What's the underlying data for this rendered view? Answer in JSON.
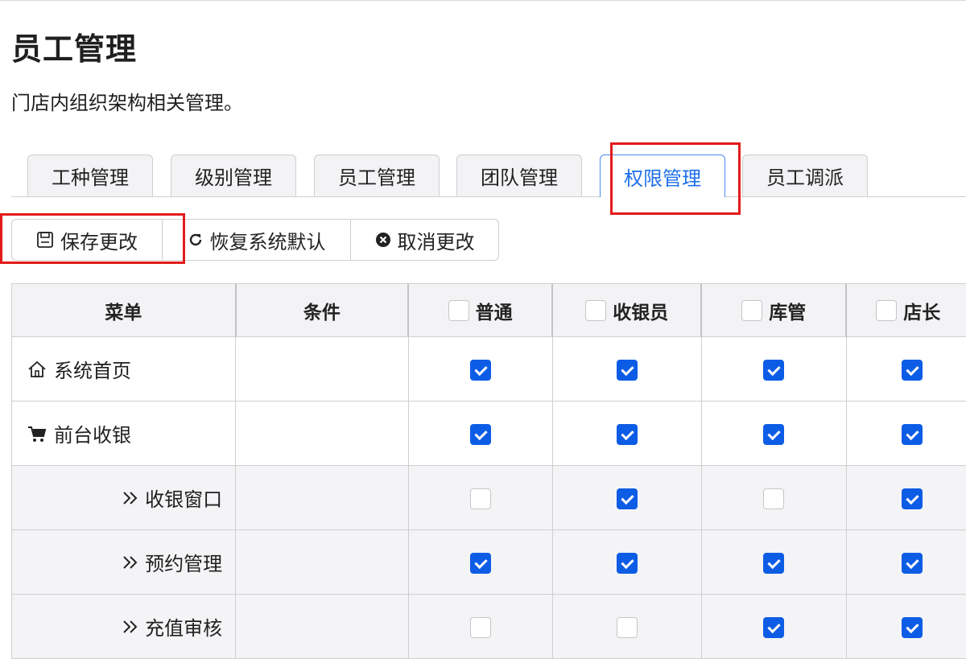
{
  "page": {
    "title": "员工管理",
    "description": "门店内组织架构相关管理。"
  },
  "tabs": [
    {
      "label": "工种管理",
      "active": false
    },
    {
      "label": "级别管理",
      "active": false
    },
    {
      "label": "员工管理",
      "active": false
    },
    {
      "label": "团队管理",
      "active": false
    },
    {
      "label": "权限管理",
      "active": true
    },
    {
      "label": "员工调派",
      "active": false
    }
  ],
  "toolbar": {
    "save_label": "保存更改",
    "restore_label": "恢复系统默认",
    "cancel_label": "取消更改"
  },
  "table": {
    "headers": {
      "menu": "菜单",
      "condition": "条件",
      "roles": [
        {
          "label": "普通",
          "checked": false
        },
        {
          "label": "收银员",
          "checked": false
        },
        {
          "label": "库管",
          "checked": false
        },
        {
          "label": "店长",
          "checked": false
        }
      ]
    },
    "rows": [
      {
        "label": "系统首页",
        "icon": "home-icon",
        "level": "top",
        "condition": "",
        "perms": [
          true,
          true,
          true,
          true
        ]
      },
      {
        "label": "前台收银",
        "icon": "cart-icon",
        "level": "top",
        "condition": "",
        "perms": [
          true,
          true,
          true,
          true
        ]
      },
      {
        "label": "收银窗口",
        "icon": "double-chevron-right-icon",
        "level": "sub",
        "condition": "",
        "perms": [
          false,
          true,
          false,
          true
        ]
      },
      {
        "label": "预约管理",
        "icon": "double-chevron-right-icon",
        "level": "sub",
        "condition": "",
        "perms": [
          true,
          true,
          true,
          true
        ]
      },
      {
        "label": "充值审核",
        "icon": "double-chevron-right-icon",
        "level": "sub",
        "condition": "",
        "perms": [
          false,
          false,
          true,
          true
        ]
      }
    ]
  },
  "colors": {
    "accent": "#0d5ce6",
    "active_tab_text": "#1f6feb",
    "highlight": "#e31b1b",
    "header_bg": "#f3f3f5",
    "border": "#cfcfcf"
  }
}
